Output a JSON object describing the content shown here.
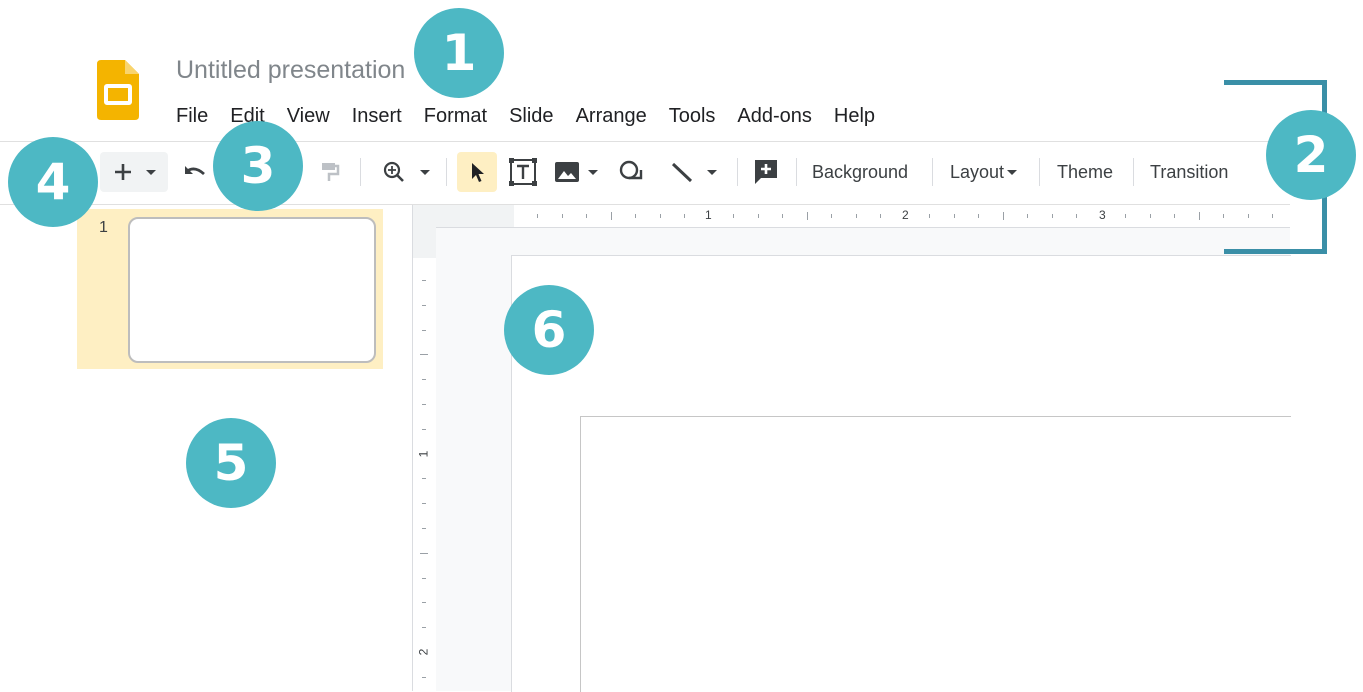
{
  "header": {
    "title": "Untitled presentation",
    "menu": [
      "File",
      "Edit",
      "View",
      "Insert",
      "Format",
      "Slide",
      "Arrange",
      "Tools",
      "Add-ons",
      "Help"
    ]
  },
  "toolbar": {
    "background_label": "Background",
    "layout_label": "Layout",
    "theme_label": "Theme",
    "transition_label": "Transition"
  },
  "filmstrip": {
    "slides": [
      {
        "number": "1"
      }
    ]
  },
  "ruler": {
    "h_labels": [
      "1",
      "2",
      "3"
    ],
    "v_labels": [
      "1",
      "2"
    ]
  },
  "callouts": [
    "1",
    "2",
    "3",
    "4",
    "5",
    "6"
  ],
  "colors": {
    "callout": "#4db8c4",
    "bracket": "#3a8fa7",
    "selected_thumb": "#feefc3",
    "active_tool": "#feefc3",
    "logo": "#f4b400"
  },
  "icons": {
    "logo": "google-slides-logo",
    "new": "plus-icon",
    "undo": "undo-icon",
    "paint_format": "paint-format-icon",
    "zoom": "zoom-icon",
    "select": "cursor-icon",
    "textbox": "textbox-icon",
    "image": "image-icon",
    "shape": "shape-icon",
    "line": "line-icon",
    "comment": "add-comment-icon"
  }
}
